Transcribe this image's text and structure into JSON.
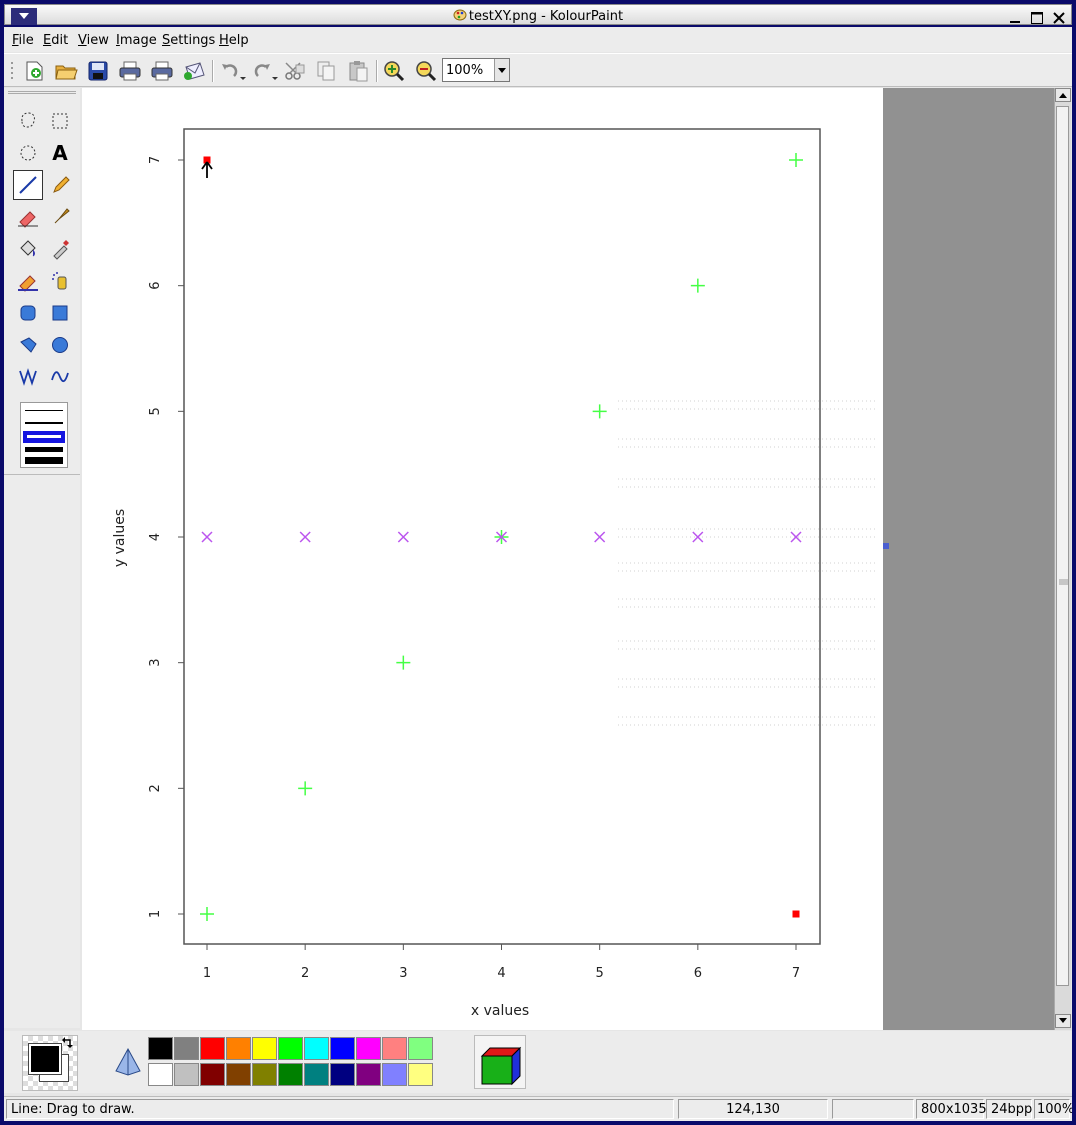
{
  "window": {
    "title": "testXY.png - KolourPaint",
    "icon": "kolourpaint-palette-icon"
  },
  "menubar": {
    "items": [
      {
        "label": "File",
        "mnemonic": "F"
      },
      {
        "label": "Edit",
        "mnemonic": "E"
      },
      {
        "label": "View",
        "mnemonic": "V"
      },
      {
        "label": "Image",
        "mnemonic": "I"
      },
      {
        "label": "Settings",
        "mnemonic": "S"
      },
      {
        "label": "Help",
        "mnemonic": "H"
      }
    ]
  },
  "toolbar": {
    "icons": [
      "new-icon",
      "open-icon",
      "save-icon",
      "print-icon",
      "print-preview-icon",
      "mail-icon",
      "undo-icon",
      "redo-icon",
      "cut-icon",
      "copy-icon",
      "paste-icon",
      "zoom-in-icon",
      "zoom-out-icon"
    ],
    "zoom_value": "100%"
  },
  "tools": {
    "items": [
      "free-select-icon",
      "rect-select-icon",
      "ellipse-select-icon",
      "text-icon",
      "line-icon",
      "pen-icon",
      "eraser-icon",
      "brush-icon",
      "flood-fill-icon",
      "color-picker-icon",
      "color-eraser-icon",
      "spraycan-icon",
      "rounded-rect-icon",
      "rect-icon",
      "polygon-icon",
      "ellipse-icon",
      "polyline-icon",
      "curve-icon"
    ],
    "selected": "line-icon",
    "text_glyph": "A"
  },
  "image_plot": {
    "x_label": "x values",
    "y_label": "y values",
    "x_ticks": [
      "1",
      "2",
      "3",
      "4",
      "5",
      "6",
      "7"
    ],
    "y_ticks": [
      "1",
      "2",
      "3",
      "4",
      "5",
      "6",
      "7"
    ]
  },
  "chart_data": {
    "type": "scatter",
    "xlabel": "x values",
    "ylabel": "y values",
    "xlim": [
      1,
      7
    ],
    "ylim": [
      1,
      7
    ],
    "grid": false,
    "series": [
      {
        "marker": "plus",
        "color": "#44ff44",
        "x": [
          1,
          2,
          3,
          4,
          5,
          6,
          7
        ],
        "y": [
          1,
          2,
          3,
          4,
          5,
          6,
          7
        ]
      },
      {
        "marker": "x",
        "color": "#bb55ee",
        "x": [
          1,
          2,
          3,
          4,
          5,
          6,
          7
        ],
        "y": [
          4,
          4,
          4,
          4,
          4,
          4,
          4
        ]
      },
      {
        "marker": "square",
        "color": "#ff0000",
        "x": [
          1,
          7
        ],
        "y": [
          7,
          1
        ]
      }
    ]
  },
  "palette": {
    "foreground": "#000000",
    "background": "#ffffff",
    "top_row": [
      "#000000",
      "#808080",
      "#ff0000",
      "#ff8000",
      "#ffff00",
      "#00ff00",
      "#00ffff",
      "#0000ff",
      "#ff00ff",
      "#ff8080",
      "#80ff80"
    ],
    "bottom_row": [
      "#ffffff",
      "#c0c0c0",
      "#800000",
      "#804000",
      "#808000",
      "#008000",
      "#008080",
      "#000080",
      "#800080",
      "#8080ff",
      "#ffff80"
    ]
  },
  "status": {
    "message": "Line: Drag to draw.",
    "coords": "124,130",
    "selection": "",
    "dimensions": "800x1035",
    "depth": "24bpp",
    "zoom": "100%"
  }
}
